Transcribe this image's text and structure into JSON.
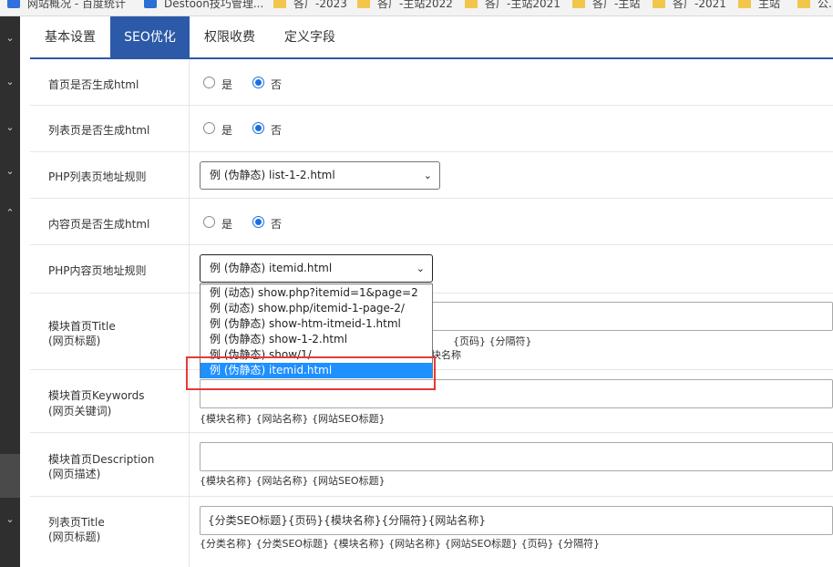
{
  "bookmarks": [
    {
      "label": "网站概况 - 百度统计",
      "icon": "baidu-icon"
    },
    {
      "label": "Destoon技巧管理...",
      "icon": "x-icon"
    },
    {
      "label": "各厂-2023",
      "icon": "folder-icon"
    },
    {
      "label": "各厂-主站2022",
      "icon": "folder-icon"
    },
    {
      "label": "各厂-主站2021",
      "icon": "folder-icon"
    },
    {
      "label": "各厂-主站",
      "icon": "folder-icon"
    },
    {
      "label": "各厂-2021",
      "icon": "folder-icon"
    },
    {
      "label": "主站",
      "icon": "folder-icon"
    },
    {
      "label": "公...",
      "icon": "folder-icon"
    }
  ],
  "tabs": [
    {
      "label": "基本设置",
      "active": false
    },
    {
      "label": "SEO优化",
      "active": true
    },
    {
      "label": "权限收费",
      "active": false
    },
    {
      "label": "定义字段",
      "active": false
    }
  ],
  "radio_labels": {
    "yes": "是",
    "no": "否"
  },
  "rows": {
    "index_html": {
      "label": "首页是否生成html",
      "value": "否"
    },
    "list_html": {
      "label": "列表页是否生成html",
      "value": "否"
    },
    "php_list_rule": {
      "label": "PHP列表页地址规则",
      "selected": "例 (伪静态) list-1-2.html"
    },
    "content_html": {
      "label": "内容页是否生成html",
      "value": "否"
    },
    "php_content_rule": {
      "label": "PHP内容页地址规则",
      "selected": "例 (伪静态) itemid.html"
    },
    "module_title": {
      "label": "模块首页Title",
      "sub": "(网页标题)",
      "hint_line1": "{页码} {分隔符}",
      "hint_line2": "块名称"
    },
    "module_keywords": {
      "label": "模块首页Keywords",
      "sub": "(网页关键词)",
      "value": "",
      "hint": "{模块名称} {网站名称} {网站SEO标题}"
    },
    "module_description": {
      "label": "模块首页Description",
      "sub": "(网页描述)",
      "value": "",
      "hint": "{模块名称} {网站名称} {网站SEO标题}"
    },
    "list_title": {
      "label": "列表页Title",
      "sub": "(网页标题)",
      "value": "{分类SEO标题}{页码}{模块名称}{分隔符}{网站名称}",
      "hint": "{分类名称} {分类SEO标题} {模块名称} {网站名称} {网站SEO标题} {页码} {分隔符}"
    }
  },
  "dropdown_options": [
    {
      "label": "例 (动态) show.php?itemid=1&page=2",
      "selected": false
    },
    {
      "label": "例 (动态) show.php/itemid-1-page-2/",
      "selected": false
    },
    {
      "label": "例 (伪静态) show-htm-itmeid-1.html",
      "selected": false
    },
    {
      "label": "例 (伪静态) show-1-2.html",
      "selected": false
    },
    {
      "label": "例 (伪静态) show/1/",
      "selected": false
    },
    {
      "label": "例 (伪静态) itemid.html",
      "selected": true
    }
  ],
  "sidebar_icons": [
    "chevron-down-icon",
    "chevron-down-icon",
    "chevron-down-icon",
    "chevron-up-icon",
    "chevron-down-icon"
  ],
  "colors": {
    "accent": "#2d5aa8",
    "selection": "#1e90ff",
    "highlight_border": "#e53935"
  }
}
